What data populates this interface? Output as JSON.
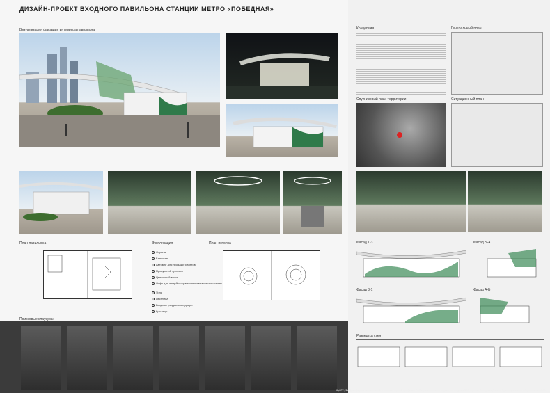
{
  "title": "ДИЗАЙН-ПРОЕКТ ВХОДНОГО ПАВИЛЬОНА СТАНЦИИ МЕТРО «ПОБЕДНАЯ»",
  "sections": {
    "visualization": "Визуализация фасада и интерьера павильона",
    "plan_pavilion": "План павильона",
    "explication": "Экспликация",
    "plan_ceiling": "План потолка",
    "search_models": "Поисковые клаузуры",
    "concept": "Концепция",
    "general_plan": "Генеральный план",
    "satellite_plan": "Спутниковый план территории",
    "situational_plan": "Ситуационный план",
    "facade_1_3": "Фасад 1-3",
    "facade_b_a": "Фасад Б-А",
    "facade_3_1": "Фасад 3-1",
    "facade_a_b": "Фасад А-Б",
    "wall_sweep": "Развертка стен"
  },
  "explication_items": [
    "Охрана",
    "Банкомат",
    "Автомат для продажи билетов",
    "Пропускной турникет",
    "Цветочный вазон",
    "Лифт для людей с ограниченными возможностями",
    "Урна",
    "Лестница",
    "Входные раздвижные двери",
    "Крыльцо"
  ],
  "caption": "КубГУ, ФАД, кафедра технической и компьютерной графики. Работу выполнила студентка 3 курса 307 группы Шиндина Дарья. Преподаватель: Мирошников В.В."
}
